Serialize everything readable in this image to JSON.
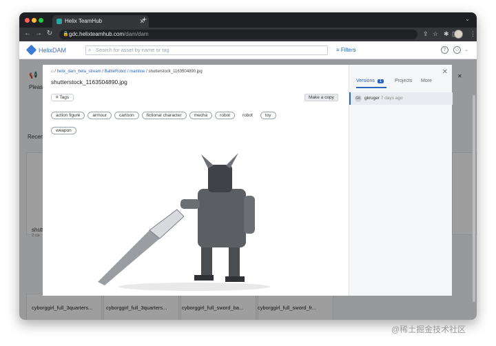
{
  "browser": {
    "tab_title": "Helix TeamHub",
    "url_host": "gdc.helixteamhub.com",
    "url_path": "/dam/dam"
  },
  "app": {
    "logo": "HelixDAM",
    "search_placeholder": "Search for asset by name or tag",
    "filters_label": "Filters"
  },
  "background": {
    "banner_fragment": "Pleas",
    "recent_fragment": "Recen",
    "thumb_fragment": "shutt",
    "thumb_fragment_sub": "2 ca",
    "bottom_labels": [
      "cyborggirl_full_3quarters...",
      "cyborggirl_full_3quarters...",
      "cyborggirl_full_sword_ba...",
      "cyborggirl_full_sword_fr..."
    ]
  },
  "modal": {
    "breadcrumb": [
      "helix_dam_beta_stream",
      "BattleRobot",
      "mainline",
      "shutterstock_1163504890.jpg"
    ],
    "file_title": "shutterstock_1163504890.jpg",
    "tags_button": "Tags",
    "copy_button": "Make a copy",
    "tags": [
      "action figure",
      "armour",
      "cartoon",
      "fictional character",
      "mecha",
      "robot",
      "robot",
      "toy",
      "weapon"
    ],
    "side": {
      "tabs": [
        "Versions",
        "Projects",
        "More"
      ],
      "version_count": "1",
      "version_user": "gkruger",
      "version_time": "7 days ago",
      "version_initials": "GK"
    }
  },
  "watermark": "@稀土掘金技术社区"
}
